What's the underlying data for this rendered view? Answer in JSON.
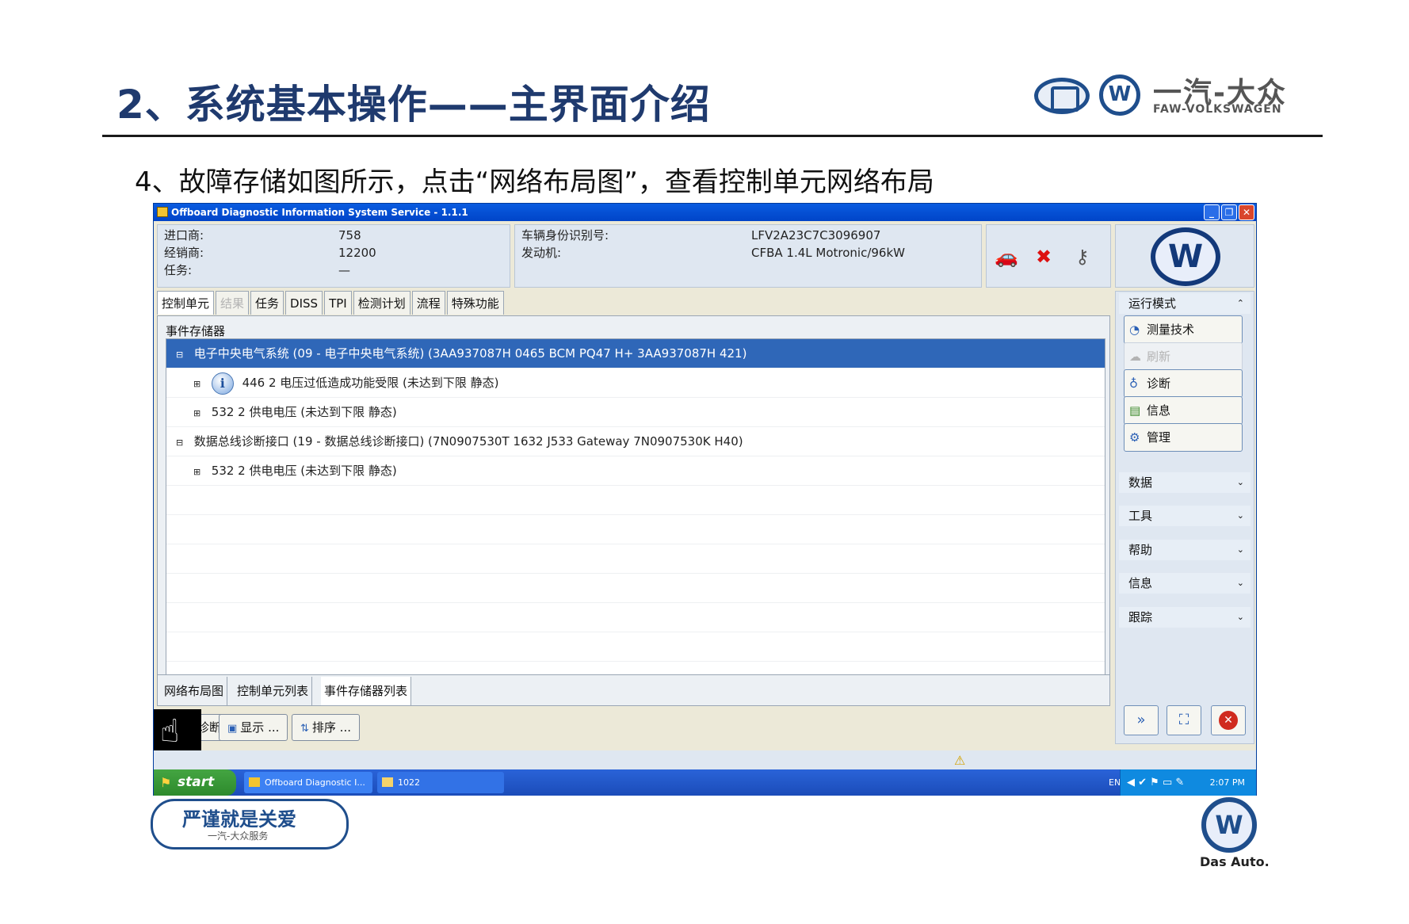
{
  "slide": {
    "title": "2、系统基本操作——主界面介绍",
    "subtitle": "4、故障存储如图所示，点击“网络布局图”，查看控制单元网络布局",
    "brand_cn": "一汽-大众",
    "brand_en": "FAW-VOLKSWAGEN",
    "footer_slogan": "严谨就是关爱",
    "footer_sub": "一汽-大众服务",
    "das_auto": "Das Auto."
  },
  "window": {
    "title": "Offboard Diagnostic Information System Service - 1.1.1",
    "controls": [
      "_",
      "❐",
      "✕"
    ]
  },
  "info": {
    "importer_label": "进口商:",
    "importer_value": "758",
    "dealer_label": "经销商:",
    "dealer_value": "12200",
    "task_label": "任务:",
    "task_value": "—",
    "vin_label": "车辆身份识别号:",
    "vin_value": "LFV2A23C7C3096907",
    "engine_label": "发动机:",
    "engine_value": "CFBA 1.4L Motronic/96kW"
  },
  "tabs": [
    {
      "label": "控制单元",
      "state": "active"
    },
    {
      "label": "结果",
      "state": "disabled"
    },
    {
      "label": "任务",
      "state": "normal"
    },
    {
      "label": "DISS",
      "state": "normal"
    },
    {
      "label": "TPI",
      "state": "normal"
    },
    {
      "label": "检测计划",
      "state": "normal"
    },
    {
      "label": "流程",
      "state": "normal"
    },
    {
      "label": "特殊功能",
      "state": "normal"
    }
  ],
  "event_memory": {
    "group_label": "事件存储器",
    "rows": [
      {
        "toggle": "⊟",
        "text": "电子中央电气系统 (09 - 电子中央电气系统) (3AA937087H    0465    BCM PQ47 H+     3AA937087H    421)",
        "selected": true
      },
      {
        "toggle": "⊞",
        "text": "446   2   电压过低造成功能受限  (未达到下限   静态)",
        "selected": false
      },
      {
        "toggle": "⊞",
        "text": "532   2   供电电压  (未达到下限   静态)",
        "selected": false
      },
      {
        "toggle": "⊟",
        "text": "数据总线诊断接口 (19 - 数据总线诊断接口) (7N0907530T    1632   J533  Gateway   7N0907530K    H40)",
        "selected": false
      },
      {
        "toggle": "⊞",
        "text": "532   2   供电电压  (未达到下限   静态)",
        "selected": false
      }
    ]
  },
  "bottom_tabs": [
    "网络布局图",
    "控制单元列表",
    "事件存储器列表"
  ],
  "actions": {
    "diagnose": "诊断",
    "display": "显示  ...",
    "sort": "排序  ..."
  },
  "sidebar": {
    "mode_label": "运行模式",
    "mode_buttons": [
      {
        "label": "测量技术",
        "icon": "gauge-icon",
        "enabled": true
      },
      {
        "label": "刷新",
        "icon": "refresh-icon",
        "enabled": false
      },
      {
        "label": "诊断",
        "icon": "stethoscope-icon",
        "enabled": true
      },
      {
        "label": "信息",
        "icon": "books-icon",
        "enabled": true
      },
      {
        "label": "管理",
        "icon": "gear-icon",
        "enabled": true
      }
    ],
    "sections": [
      "数据",
      "工具",
      "帮助",
      "信息",
      "跟踪"
    ]
  },
  "taskbar": {
    "start": "start",
    "tasks": [
      "Offboard Diagnostic I...",
      "1022"
    ],
    "lang": "EN",
    "clock": "2:07 PM"
  }
}
